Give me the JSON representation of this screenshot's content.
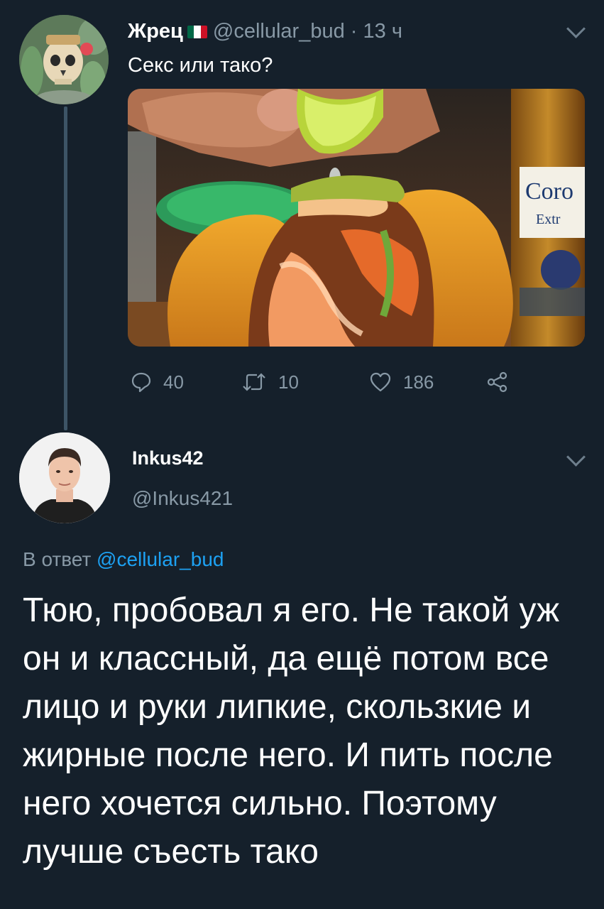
{
  "tweet": {
    "author_name": "Жрец",
    "author_handle": "@cellular_bud",
    "separator": "·",
    "time": "13 ч",
    "text": "Секс или тако?",
    "flag_icon": "mexico-flag-icon",
    "stats": {
      "replies": "40",
      "retweets": "10",
      "likes": "186"
    }
  },
  "reply": {
    "author_name": "Inkus42",
    "author_handle": "@Inkus421",
    "reply_prefix": "В ответ",
    "reply_to": "@cellular_bud",
    "text": "Тюю, пробовал я его. Не такой уж он и классный, да ещё потом все лицо и руки липкие, скользкие и жирные после него. И пить после него хочется сильно. Поэтому лучше съесть тако"
  },
  "media_text": {
    "bottle_label_1": "Coro",
    "bottle_label_2": "Extr"
  },
  "colors": {
    "background": "#15202b",
    "secondary_text": "#8899a6",
    "link": "#1da1f2",
    "thread_line": "#3d5466"
  }
}
